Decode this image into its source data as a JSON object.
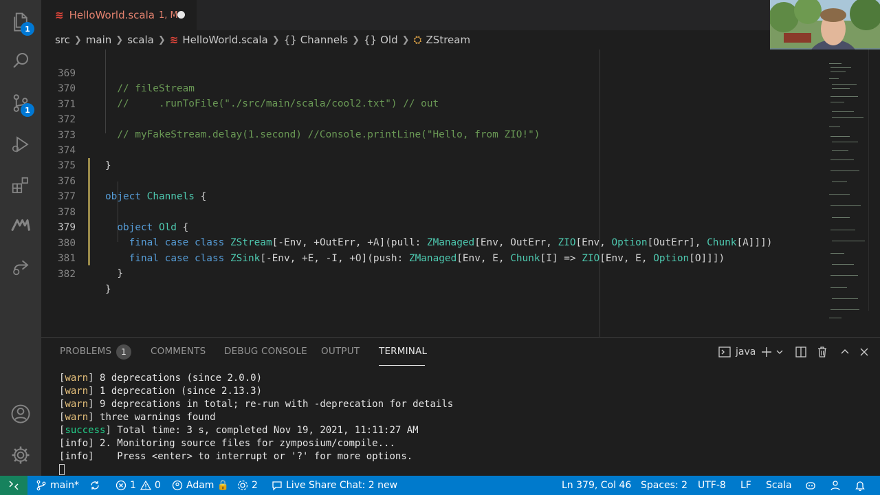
{
  "activity_bar": {
    "explorer_badge": "1",
    "source_control_badge": "1"
  },
  "tab": {
    "filename": "HelloWorld.scala",
    "status": "1, M"
  },
  "breadcrumbs": {
    "items": [
      "src",
      "main",
      "scala",
      "HelloWorld.scala",
      "Channels",
      "Old",
      "ZStream"
    ]
  },
  "editor": {
    "active_line": "379",
    "lines": [
      {
        "n": "369",
        "text": "  // fileStream"
      },
      {
        "n": "370",
        "text": "  //     .runToFile(\"./src/main/scala/cool2.txt\") // out"
      },
      {
        "n": "371",
        "text": ""
      },
      {
        "n": "372",
        "text": "  // myFakeStream.delay(1.second) //Console.printLine(\"Hello, from ZIO!\")"
      },
      {
        "n": "373",
        "text": ""
      },
      {
        "n": "374",
        "text": "}"
      },
      {
        "n": "375",
        "text": ""
      },
      {
        "n": "376",
        "text": "object Channels {"
      },
      {
        "n": "377",
        "text": ""
      },
      {
        "n": "378",
        "text": "  object Old {"
      },
      {
        "n": "379",
        "text": "    final case class ZStream[-Env, +OutErr, +A](pull: ZManaged[Env, OutErr, ZIO[Env, Option[OutErr], Chunk[A]]])"
      },
      {
        "n": "380",
        "text": "    final case class ZSink[-Env, +E, -I, +O](push: ZManaged[Env, E, Chunk[I] => ZIO[Env, E, Option[O]]])"
      },
      {
        "n": "381",
        "text": "  }"
      },
      {
        "n": "382",
        "text": "}"
      }
    ]
  },
  "panel": {
    "tabs": [
      "PROBLEMS",
      "COMMENTS",
      "DEBUG CONSOLE",
      "OUTPUT",
      "TERMINAL"
    ],
    "problems_count": "1",
    "active_tab": "TERMINAL",
    "terminal_name": "java",
    "terminal_lines": [
      {
        "tag": "warn",
        "text": " 8 deprecations (since 2.0.0)"
      },
      {
        "tag": "warn",
        "text": " 1 deprecation (since 2.13.3)"
      },
      {
        "tag": "warn",
        "text": " 9 deprecations in total; re-run with -deprecation for details"
      },
      {
        "tag": "warn",
        "text": " three warnings found"
      },
      {
        "tag": "success",
        "text": " Total time: 3 s, completed Nov 19, 2021, 11:11:27 AM"
      },
      {
        "tag": "info",
        "text": " 2. Monitoring source files for zymposium/compile..."
      },
      {
        "tag": "info",
        "text": "    Press <enter> to interrupt or '?' for more options."
      }
    ]
  },
  "status_bar": {
    "branch": "main*",
    "errors": "1",
    "warnings": "0",
    "user": "Adam",
    "live_share_count": "2",
    "live_share_chat": "Live Share Chat: 2 new",
    "position": "Ln 379, Col 46",
    "spaces": "Spaces: 2",
    "encoding": "UTF-8",
    "eol": "LF",
    "language": "Scala"
  },
  "colors": {
    "status_bar": "#007acc",
    "remote": "#16825d",
    "keyword": "#569cd6",
    "comment": "#6a9955",
    "type": "#4ec9b0",
    "tab_modified": "#e2816e"
  }
}
